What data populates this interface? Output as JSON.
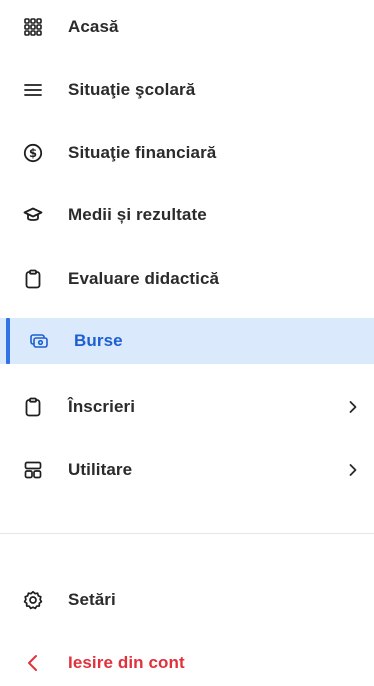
{
  "colors": {
    "active_bg": "#dbe9fc",
    "active_text": "#1c5fd1",
    "active_bar": "#2f73e5",
    "logout": "#e0313c"
  },
  "menu": {
    "items": [
      {
        "label": "Acasă",
        "icon": "grid-icon"
      },
      {
        "label": "Situaţie şcolară",
        "icon": "list-icon"
      },
      {
        "label": "Situaţie financiară",
        "icon": "dollar-icon"
      },
      {
        "label": "Medii și rezultate",
        "icon": "graduation-cap-icon"
      },
      {
        "label": "Evaluare didactică",
        "icon": "clipboard-icon"
      },
      {
        "label": "Burse",
        "icon": "banknote-icon",
        "active": true
      },
      {
        "label": "Înscrieri",
        "icon": "clipboard-icon",
        "expandable": true
      },
      {
        "label": "Utilitare",
        "icon": "layout-icon",
        "expandable": true
      }
    ],
    "settings_label": "Setări",
    "logout_label": "Iesire din cont"
  }
}
